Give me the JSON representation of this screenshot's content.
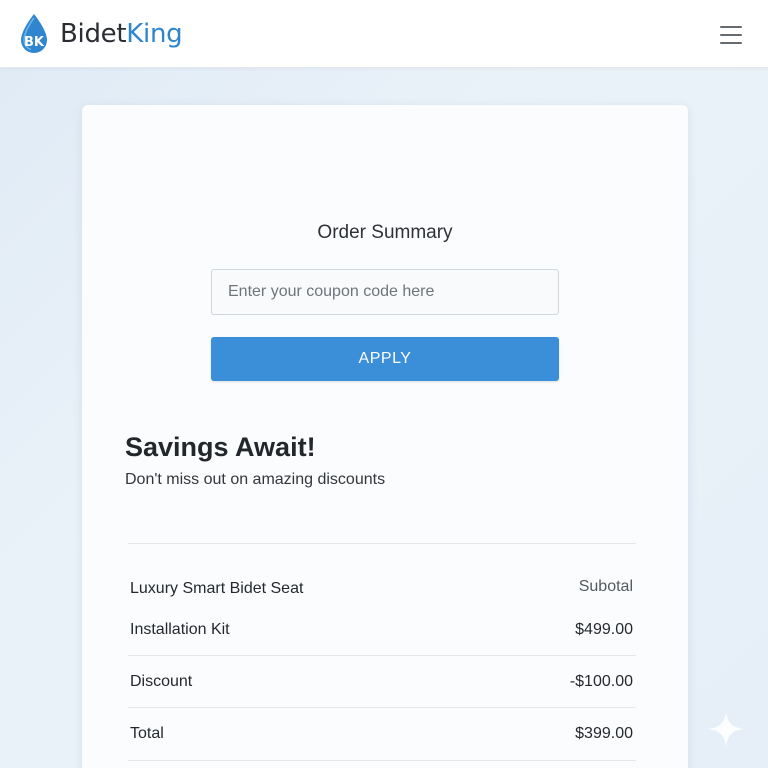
{
  "header": {
    "brand_part1": "Bidet",
    "brand_part2": "King",
    "logo_icon": "water-drop-logo-icon",
    "menu_icon": "hamburger-menu-icon"
  },
  "order": {
    "title": "Order Summary",
    "coupon": {
      "placeholder": "Enter your coupon code here",
      "value": ""
    },
    "apply_label": "APPLY"
  },
  "promo": {
    "title": "Savings Await!",
    "subtitle": "Don't miss out on amazing discounts"
  },
  "summary": {
    "rows": [
      {
        "label": "Luxury Smart Bidet Seat",
        "value": "Subotal"
      },
      {
        "label": "Installation Kit",
        "value": "$499.00"
      },
      {
        "label": "Discount",
        "value": "-$100.00"
      },
      {
        "label": "Total",
        "value": "$399.00"
      }
    ]
  },
  "colors": {
    "accent": "#3a8fd8",
    "brand_blue": "#2f86cf",
    "background": "#e6eff8"
  }
}
